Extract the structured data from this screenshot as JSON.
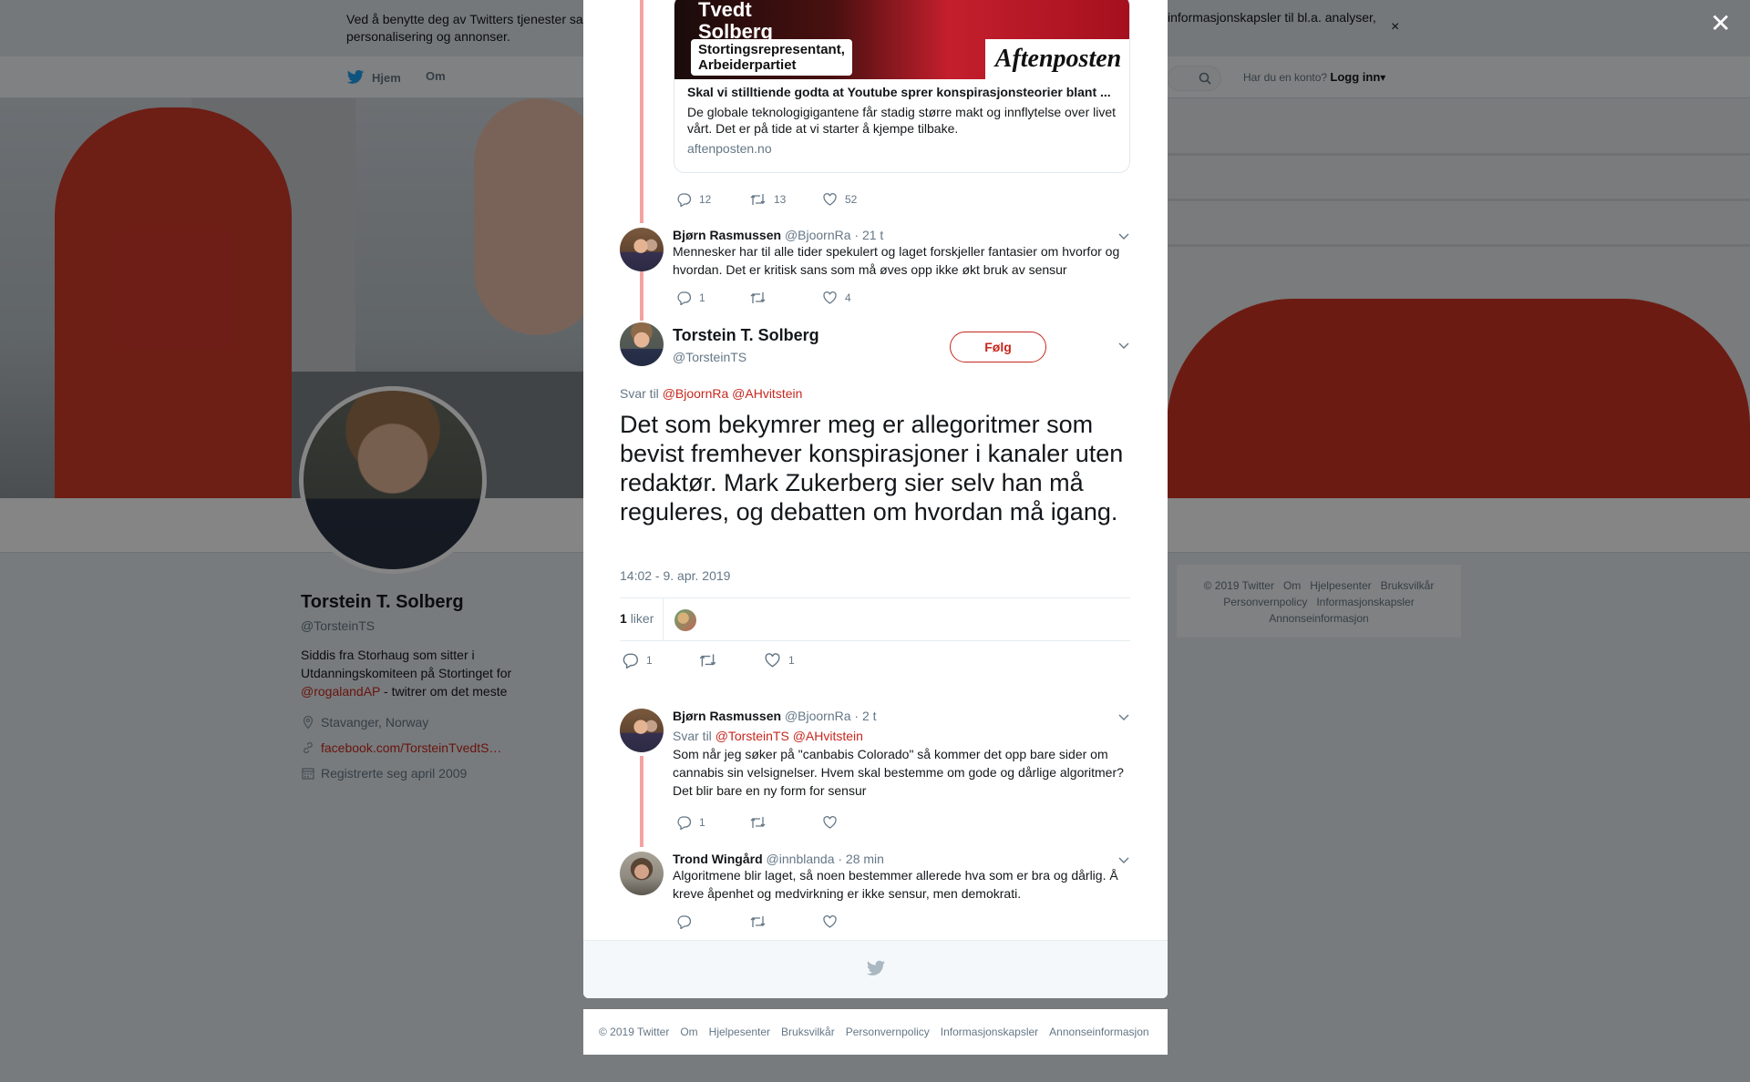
{
  "cookie": {
    "text_left": "Ved å benytte deg av Twitters tjenester sa",
    "text_left_2": "personalisering og annonser.",
    "text_right": "informasjonskapsler til bl.a. analyser,",
    "close": "×"
  },
  "nav": {
    "home": "Hjem",
    "about": "Om",
    "account_prompt": "Har du en konto?",
    "login": "Logg inn"
  },
  "profile": {
    "name": "Torstein T. Solberg",
    "handle": "@TorsteinTS",
    "bio_1": "Siddis fra Storhaug som sitter i Utdanningskomiteen på Stortinget for",
    "bio_link": "@rogalandAP",
    "bio_2": " - twitrer om det meste",
    "location": "Stavanger, Norway",
    "website": "facebook.com/TorsteinTvedtS…",
    "joined": "Registrerte seg april 2009"
  },
  "side_footer": {
    "items_row1": [
      "© 2019 Twitter",
      "Om",
      "Hjelpesenter",
      "Bruksvilkår"
    ],
    "items_row2": [
      "Personvernpolicy",
      "Informasjonskapsler"
    ],
    "items_row3": [
      "Annonseinformasjon"
    ]
  },
  "overlay_close": "✕",
  "card": {
    "overlay_name_1": "Tvedt",
    "overlay_name_2": "Solberg",
    "tag_1": "Stortingsrepresentant,",
    "tag_2": "Arbeiderpartiet",
    "logo": "Aftenposten",
    "title": "Skal vi stilltiende godta at Youtube sprer konspirasjonsteorier blant ...",
    "desc": "De globale teknologigigantene får stadig større makt og innflytelse over livet vårt. Det er på tide at vi starter å kjempe tilbake.",
    "domain": "aftenposten.no"
  },
  "card_actions": {
    "replies": "12",
    "retweets": "13",
    "likes": "52"
  },
  "tweet_bjorn1": {
    "name": "Bjørn Rasmussen",
    "handle": "@BjoornRa",
    "time": "· 21 t",
    "text": "Mennesker har til alle tider spekulert og laget forskjeller fantasier om hvorfor og hvordan. Det er kritisk sans som må øves opp ikke økt bruk av sensur",
    "replies": "1",
    "retweets": "",
    "likes": "4"
  },
  "main_tweet": {
    "name": "Torstein T. Solberg",
    "handle": "@TorsteinTS",
    "follow": "Følg",
    "reply_prefix": "Svar til",
    "reply_to": "@BjoornRa @AHvitstein",
    "text": "Det som bekymrer meg er allegoritmer som bevist fremhever konspirasjoner i kanaler uten redaktør. Mark Zukerberg sier selv han må reguleres, og debatten om hvordan må igang.",
    "timestamp": "14:02 - 9. apr. 2019",
    "like_count": "1",
    "like_label": "liker",
    "replies": "1",
    "retweets": "",
    "likes": "1"
  },
  "tweet_bjorn2": {
    "name": "Bjørn Rasmussen",
    "handle": "@BjoornRa",
    "time": "· 2 t",
    "reply_prefix": "Svar til",
    "reply_to": "@TorsteinTS @AHvitstein",
    "text": "Som når jeg søker på \"canbabis Colorado\" så kommer det opp bare sider om cannabis sin velsignelser. Hvem skal bestemme om gode og dårlige algoritmer? Det blir bare en ny form for sensur",
    "replies": "1",
    "retweets": "",
    "likes": ""
  },
  "tweet_trond": {
    "name": "Trond Wingård",
    "handle": "@innblanda",
    "time": "· 28 min",
    "text": "Algoritmene blir laget, så noen bestemmer allerede hva som er bra og dårlig. Å kreve åpenhet og medvirkning er ikke sensur, men demokrati.",
    "replies": "",
    "retweets": "",
    "likes": ""
  },
  "modal_footer": [
    "© 2019 Twitter",
    "Om",
    "Hjelpesenter",
    "Bruksvilkår",
    "Personvernpolicy",
    "Informasjonskapsler",
    "Annonseinformasjon"
  ],
  "colors": {
    "accent": "#c6271e",
    "thread": "#f4a2a2",
    "muted": "#657786"
  }
}
